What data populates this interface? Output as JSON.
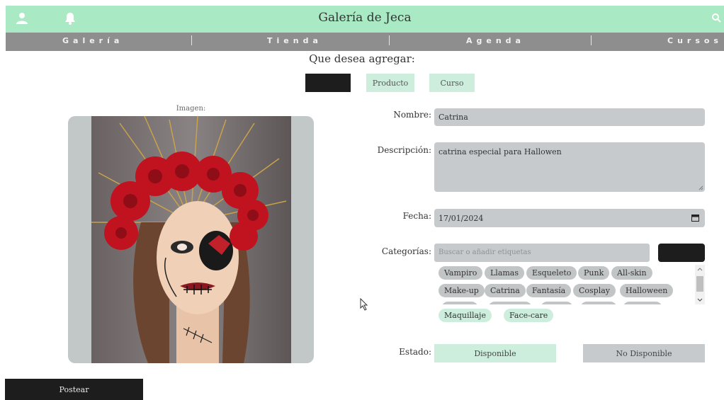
{
  "header": {
    "title": "Galería de Jeca",
    "icons": [
      "user-icon",
      "bell-icon",
      "search-icon"
    ],
    "color": "#a9e9c4"
  },
  "nav": {
    "items": [
      "Galería",
      "Tienda",
      "Agenda",
      "Cursos"
    ],
    "separator": "|",
    "color": "#8e8e8e"
  },
  "form": {
    "question": "Que desea agregar:",
    "type_buttons": {
      "first": "",
      "producto": "Producto",
      "curso": "Curso"
    },
    "image_label": "Imagen:",
    "nombre_label": "Nombre:",
    "nombre_value": "Catrina",
    "descripcion_label": "Descripción:",
    "descripcion_value": "catrina especial para Hallowen",
    "fecha_label": "Fecha:",
    "fecha_value": "17/01/2024",
    "categorias_label": "Categorías:",
    "categorias_placeholder": "Buscar o añadir etiquetas",
    "tags_row1": [
      "Vampiro",
      "Llamas",
      "Esqueleto",
      "Punk",
      "All-skin"
    ],
    "tags_row2": [
      "Make-up",
      "Catrina",
      "Fantasía",
      "Cosplay",
      "Halloween"
    ],
    "selected_tags": [
      "Maquillaje",
      "Face-care"
    ],
    "estado_label": "Estado:",
    "estado_options": [
      "Disponible",
      "No Disponible"
    ],
    "estado_selected": "Disponible",
    "post_button": "Postear",
    "accent_color": "#cdeedd"
  }
}
